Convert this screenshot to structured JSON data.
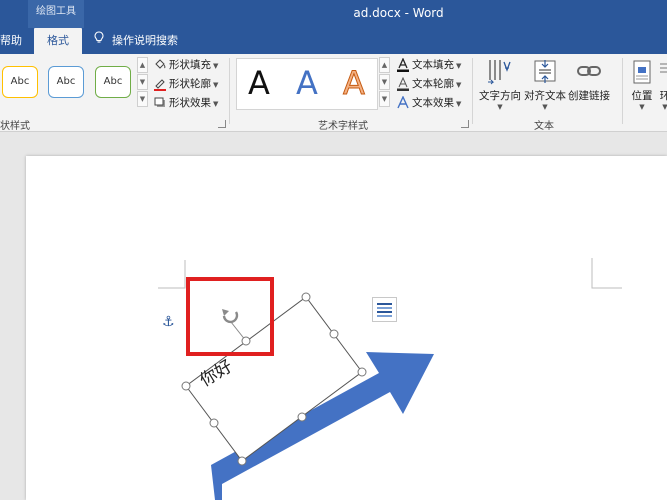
{
  "title_bar": {
    "context_group": "绘图工具",
    "document_title": "ad.docx  -  Word"
  },
  "tabs": {
    "help": "帮助",
    "format": "格式",
    "tell_me": "操作说明搜索"
  },
  "ribbon": {
    "shape_styles": {
      "group_label": "状样式",
      "gallery_items": [
        "Abc",
        "Abc",
        "Abc"
      ],
      "gallery_colors": [
        "#ffc000",
        "#5b9bd5",
        "#70ad47"
      ],
      "commands": {
        "fill": "形状填充",
        "outline": "形状轮廓",
        "effects": "形状效果"
      }
    },
    "wordart_styles": {
      "group_label": "艺术字样式",
      "gallery_items": [
        "A",
        "A",
        "A"
      ],
      "gallery_colors": [
        "#111111",
        "#4472c4",
        "#f4b183"
      ],
      "commands": {
        "fill": "文本填充",
        "outline": "文本轮廓",
        "effects": "文本效果"
      }
    },
    "text": {
      "group_label": "文本",
      "commands": {
        "direction": "文字方向",
        "align": "对齐文本",
        "link": "创建链接"
      }
    },
    "arrange": {
      "position": "位置",
      "wrap_partial": "环"
    }
  },
  "document": {
    "textbox_text": "你好",
    "arrow_color": "#4472c4",
    "highlight_color": "#e02020"
  }
}
